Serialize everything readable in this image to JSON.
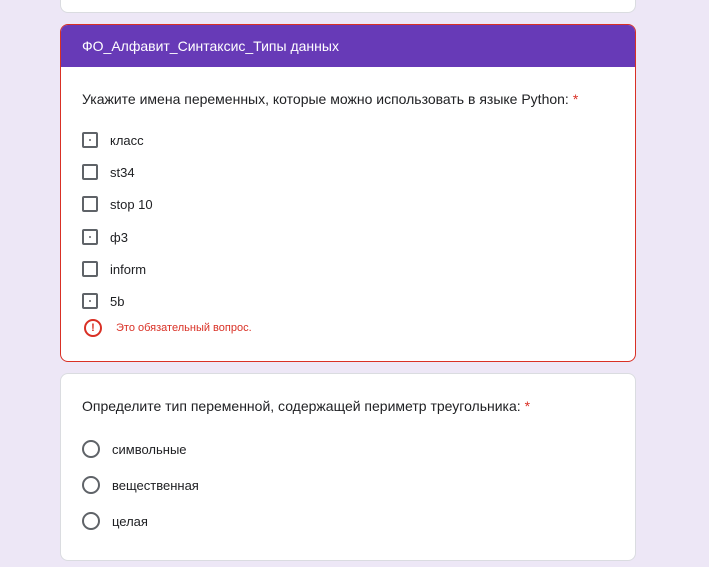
{
  "section": {
    "title": "ФО_Алфавит_Синтаксис_Типы данных"
  },
  "question1": {
    "title": "Укажите имена переменных, которые можно использовать в языке Python:",
    "required_mark": "*",
    "options": [
      {
        "label": "класс",
        "marked": true
      },
      {
        "label": "st34",
        "marked": false
      },
      {
        "label": "stop 10",
        "marked": false
      },
      {
        "label": "ф3",
        "marked": true
      },
      {
        "label": "inform",
        "marked": false
      },
      {
        "label": "5b",
        "marked": true
      }
    ],
    "error_icon": "!",
    "error_text": "Это обязательный вопрос."
  },
  "question2": {
    "title": "Определите тип переменной, содержащей периметр треугольника:",
    "required_mark": "*",
    "options": [
      {
        "label": "символьные"
      },
      {
        "label": "вещественная"
      },
      {
        "label": "целая"
      }
    ]
  },
  "colors": {
    "accent": "#673ab7",
    "error": "#d93025",
    "background": "#ede7f6"
  }
}
